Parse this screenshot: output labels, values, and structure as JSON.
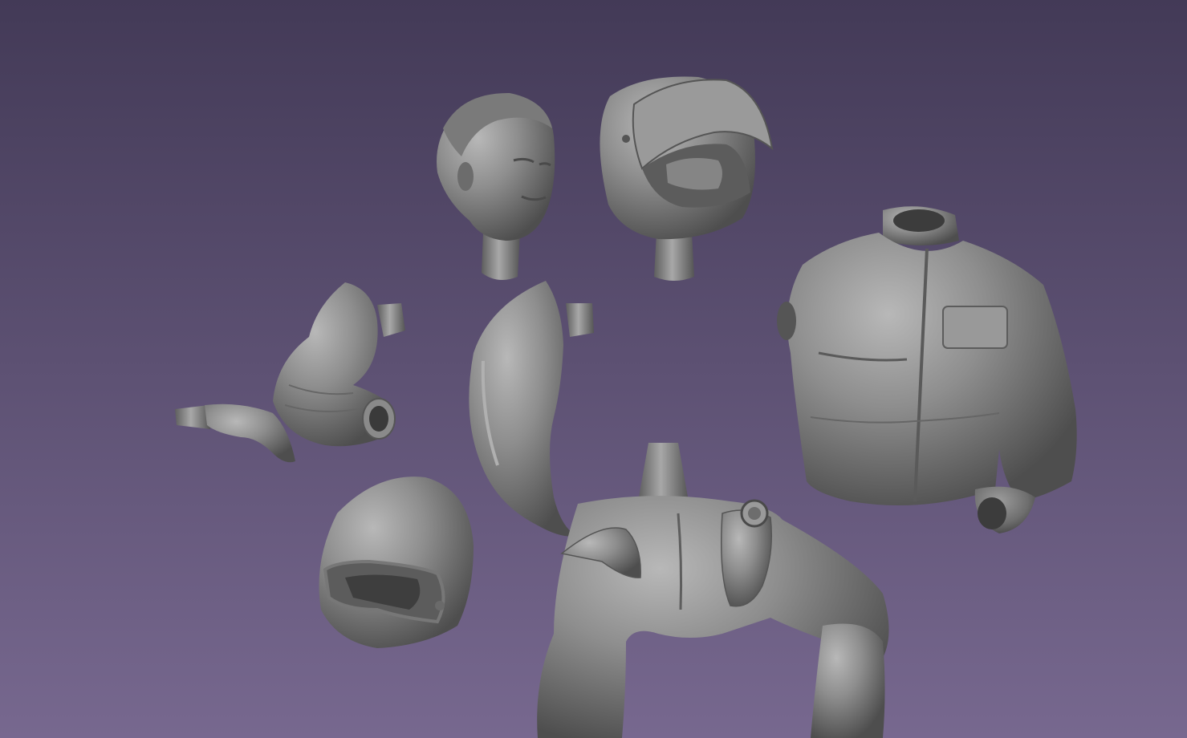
{
  "viewport": {
    "background_top": "#433a57",
    "background_bottom": "#77688f",
    "model_color": "#8a8a8a"
  },
  "parts": [
    {
      "name": "driver-head"
    },
    {
      "name": "helmet-with-visor-head"
    },
    {
      "name": "jacket-torso"
    },
    {
      "name": "left-arm-sleeve"
    },
    {
      "name": "left-hand"
    },
    {
      "name": "right-arm-sleeve"
    },
    {
      "name": "open-face-helmet"
    },
    {
      "name": "seated-legs-with-hands"
    }
  ]
}
